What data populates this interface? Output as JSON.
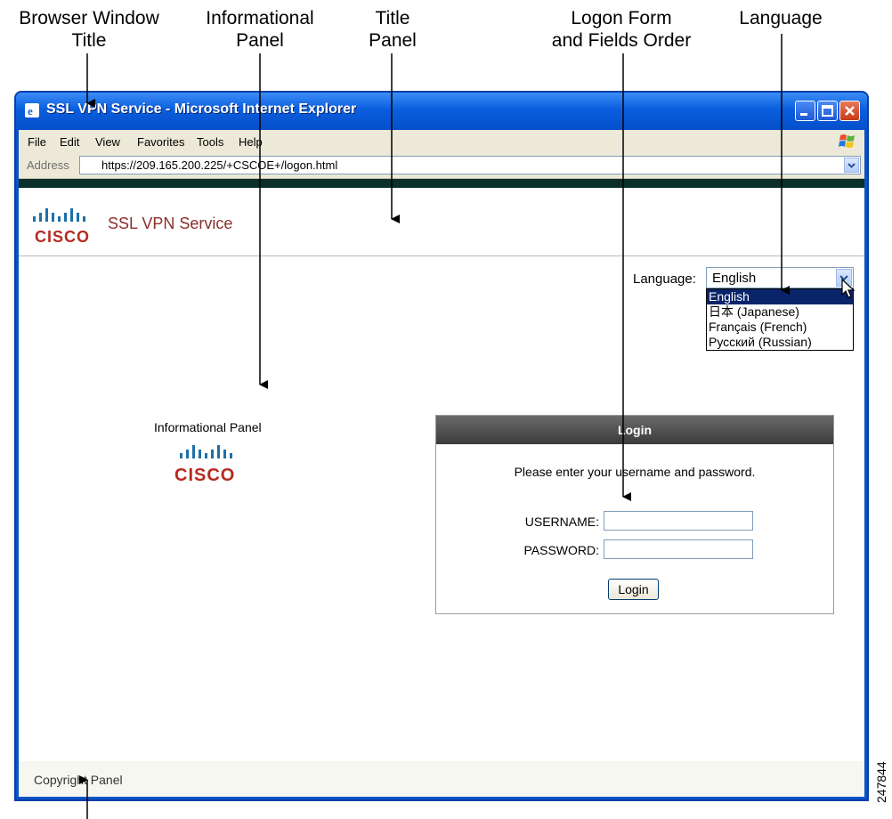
{
  "callouts": {
    "browser_window_title": [
      "Browser Window",
      "Title"
    ],
    "informational_panel": [
      "Informational",
      "Panel"
    ],
    "title_panel": [
      "Title",
      "Panel"
    ],
    "logon_form": [
      "Logon Form",
      "and Fields Order"
    ],
    "language": "Language"
  },
  "figure_id": "247844",
  "window": {
    "title": "SSL VPN Service - Microsoft Internet Explorer",
    "menu": [
      "File",
      "Edit",
      "View",
      "Favorites",
      "Tools",
      "Help"
    ],
    "address_label": "Address",
    "url": "https://209.165.200.225/+CSCOE+/logon.html"
  },
  "page": {
    "logo_text": "CISCO",
    "service_title": "SSL VPN Service",
    "language": {
      "label": "Language:",
      "selected": "English",
      "options": [
        "English",
        "日本 (Japanese)",
        "Français (French)",
        "Русский (Russian)"
      ]
    },
    "info_panel_title": "Informational Panel",
    "login": {
      "header": "Login",
      "prompt": "Please enter your username and password.",
      "username_label": "USERNAME:",
      "password_label": "PASSWORD:",
      "button": "Login"
    },
    "copyright": "Copyright Panel"
  },
  "colors": {
    "titlebar": "#0a5ede",
    "cisco_red": "#b52a1f",
    "cisco_blue": "#1e6fa8"
  }
}
